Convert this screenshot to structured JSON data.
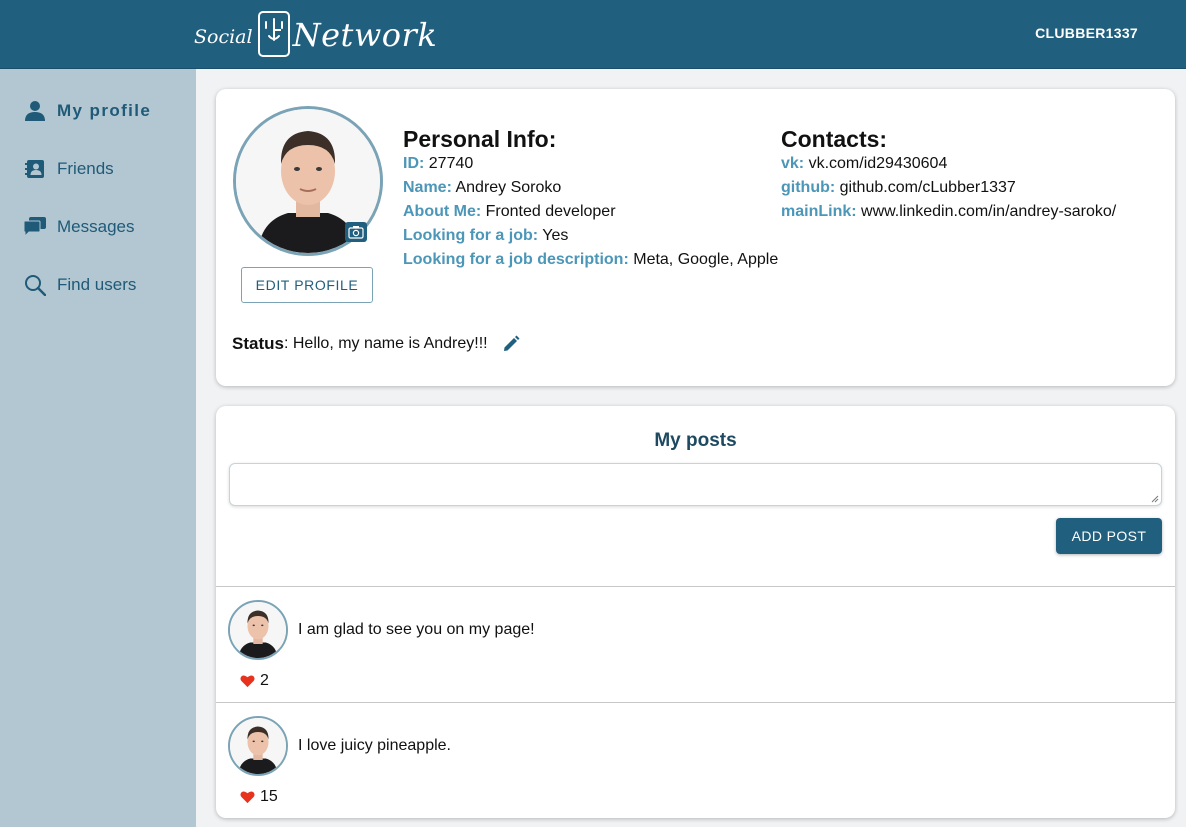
{
  "header": {
    "logo_left": "Social",
    "logo_right": "Network",
    "username": "CLUBBER1337"
  },
  "sidebar": {
    "items": [
      {
        "label": "My profile",
        "icon": "person-icon",
        "active": true
      },
      {
        "label": "Friends",
        "icon": "contacts-icon"
      },
      {
        "label": "Messages",
        "icon": "chat-icon"
      },
      {
        "label": "Find users",
        "icon": "search-icon"
      }
    ]
  },
  "profile": {
    "edit_label": "EDIT PROFILE",
    "personal_title": "Personal Info:",
    "id_label": "ID:",
    "id_value": "27740",
    "name_label": "Name:",
    "name_value": "Andrey Soroko",
    "about_label": "About Me:",
    "about_value": "Fronted developer",
    "job_label": "Looking for a job:",
    "job_value": "Yes",
    "job_desc_label": "Looking for a job description:",
    "job_desc_value": "Meta, Google, Apple",
    "contacts_title": "Contacts:",
    "vk_label": "vk:",
    "vk_value": "vk.com/id29430604",
    "github_label": "github:",
    "github_value": "github.com/cLubber1337",
    "main_label": "mainLink:",
    "main_value": "www.linkedin.com/in/andrey-saroko/",
    "status_label": "Status",
    "status_value": ": Hello, my name is Andrey!!!"
  },
  "posts": {
    "title": "My posts",
    "input_value": "",
    "add_label": "ADD POST",
    "items": [
      {
        "text": "I am glad to see you on my page!",
        "likes": "2"
      },
      {
        "text": "I love juicy pineapple.",
        "likes": "15"
      }
    ]
  },
  "colors": {
    "header_bg": "#215f7e",
    "sidebar_bg": "#b2c7d1",
    "label_accent": "#4c96b8",
    "like_heart": "#e8321e"
  }
}
